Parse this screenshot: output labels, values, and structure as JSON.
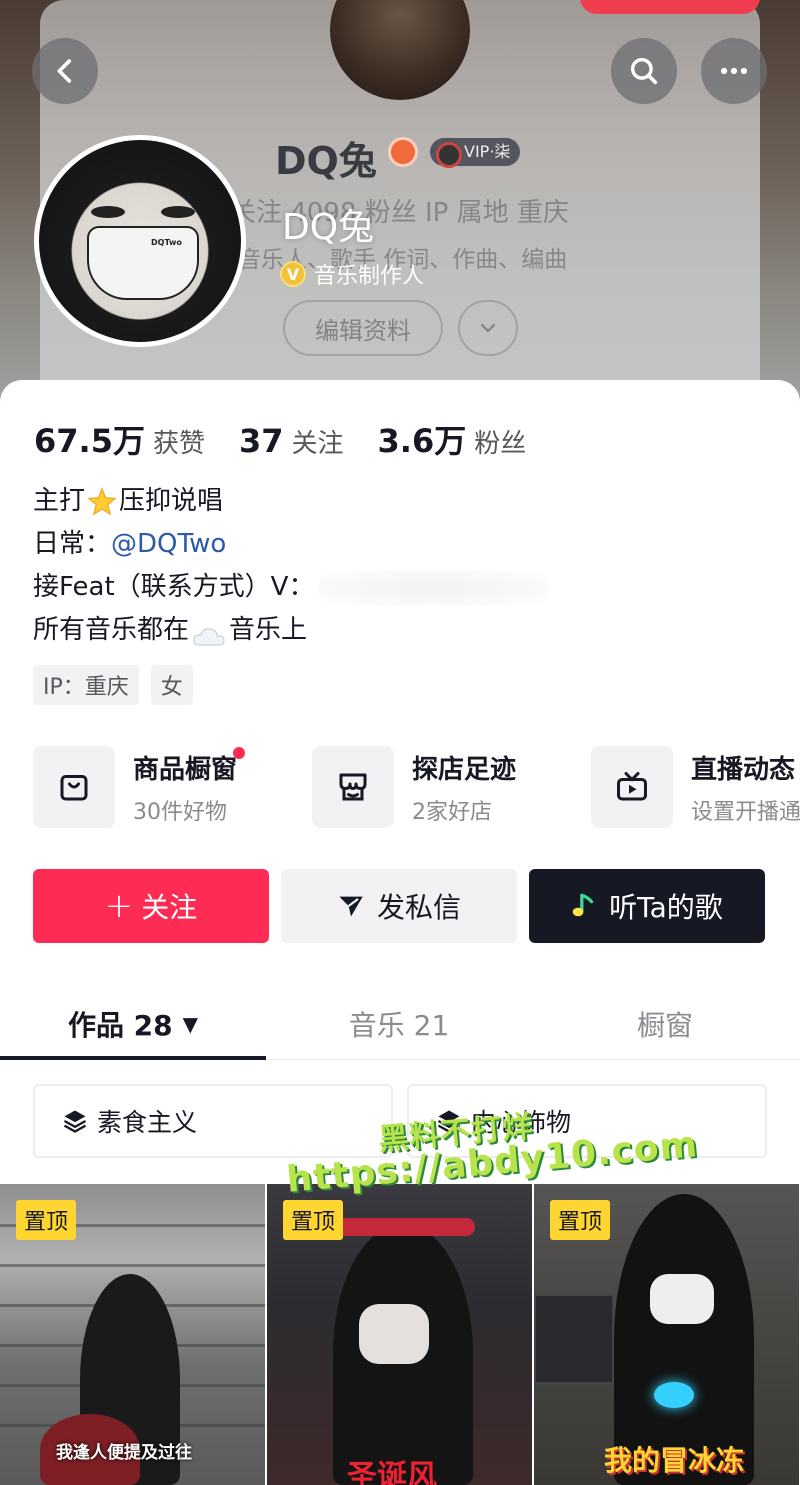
{
  "header": {
    "username": "DQ兔",
    "ghost_name": "DQ兔",
    "ghost_vip": "VIP·柒",
    "ghost_stats_line": "关注    4098 粉丝    IP 属地 重庆",
    "ghost_tags_line": "音乐人、歌手    作词、作曲、编曲",
    "verified_role": "音乐制作人",
    "edit_profile_label": "编辑资料",
    "verified_mark": "V"
  },
  "stats": [
    {
      "value": "67.5万",
      "label": "获赞"
    },
    {
      "value": "37",
      "label": "关注"
    },
    {
      "value": "3.6万",
      "label": "粉丝"
    }
  ],
  "bio": {
    "line1_prefix": "主打",
    "line1_suffix": "压抑说唱",
    "line2_prefix": "日常：",
    "line2_link": "@DQTwo",
    "line3": "接Feat（联系方式）V：",
    "line4_prefix": "所有音乐都在",
    "line4_suffix": "音乐上"
  },
  "tags": [
    "IP：重庆",
    "女"
  ],
  "services": [
    {
      "title": "商品橱窗",
      "sub": "30件好物",
      "icon": "bag-icon"
    },
    {
      "title": "探店足迹",
      "sub": "2家好店",
      "icon": "shop-icon"
    },
    {
      "title": "直播动态",
      "sub": "设置开播通知",
      "icon": "tv-icon"
    }
  ],
  "actions": {
    "follow": "关注",
    "follow_plus": "+",
    "message": "发私信",
    "music": "听Ta的歌"
  },
  "tabs": [
    {
      "label": "作品 28",
      "caret": "▼"
    },
    {
      "label": "音乐 21"
    },
    {
      "label": "橱窗"
    }
  ],
  "collections": [
    "素食主义",
    "内心饰物"
  ],
  "videos": [
    {
      "pin": "置顶",
      "caption": "我逢人便提及过往"
    },
    {
      "pin": "置顶",
      "caption": "圣诞风"
    },
    {
      "pin": "置顶",
      "caption": "我的冒冰冻"
    }
  ],
  "watermark": {
    "line1": "黑料不打烊",
    "line2": "https://abdy10.com"
  },
  "avatar_mask_text": "DQTwo",
  "colors": {
    "follow_red": "#fe2c55",
    "link_blue": "#2b5ba8",
    "pin_yellow": "#ffd631",
    "dark": "#161823"
  }
}
